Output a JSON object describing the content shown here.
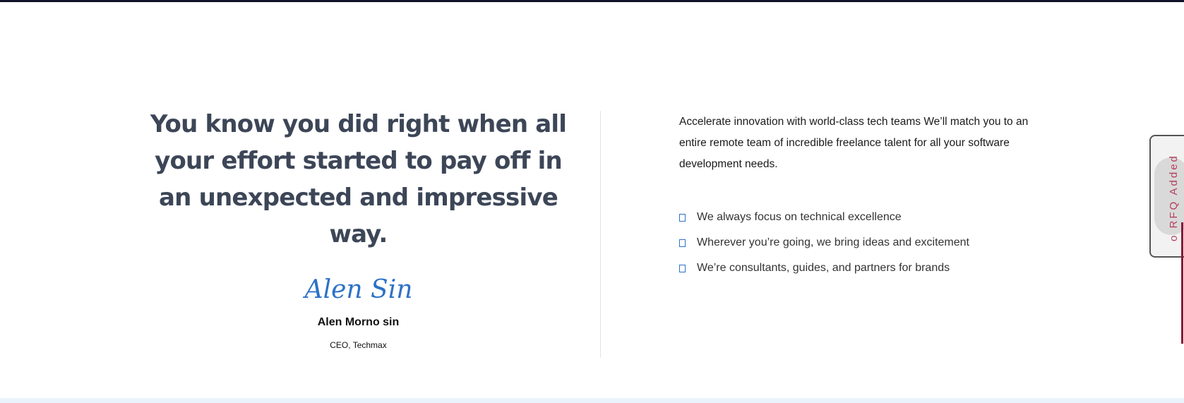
{
  "testimonial": {
    "quote": "You know you did right when all your effort started to pay off in an unexpected and impressive way.",
    "signature_text": "Alen Sin",
    "name": "Alen Morno sin",
    "role": "CEO, Techmax"
  },
  "info": {
    "intro": "Accelerate innovation with world-class tech teams We’ll match you to an entire remote team of incredible freelance talent for all your software development needs.",
    "features": [
      "We always focus on technical excellence",
      "Wherever you’re going, we bring ideas and excitement",
      "We’re consultants, guides, and partners for brands"
    ]
  },
  "rfq_tab": {
    "label": "o RFQ Added"
  },
  "colors": {
    "accent": "#2d71c7",
    "heading": "#3c4657",
    "rfq_text": "#b5405f"
  }
}
